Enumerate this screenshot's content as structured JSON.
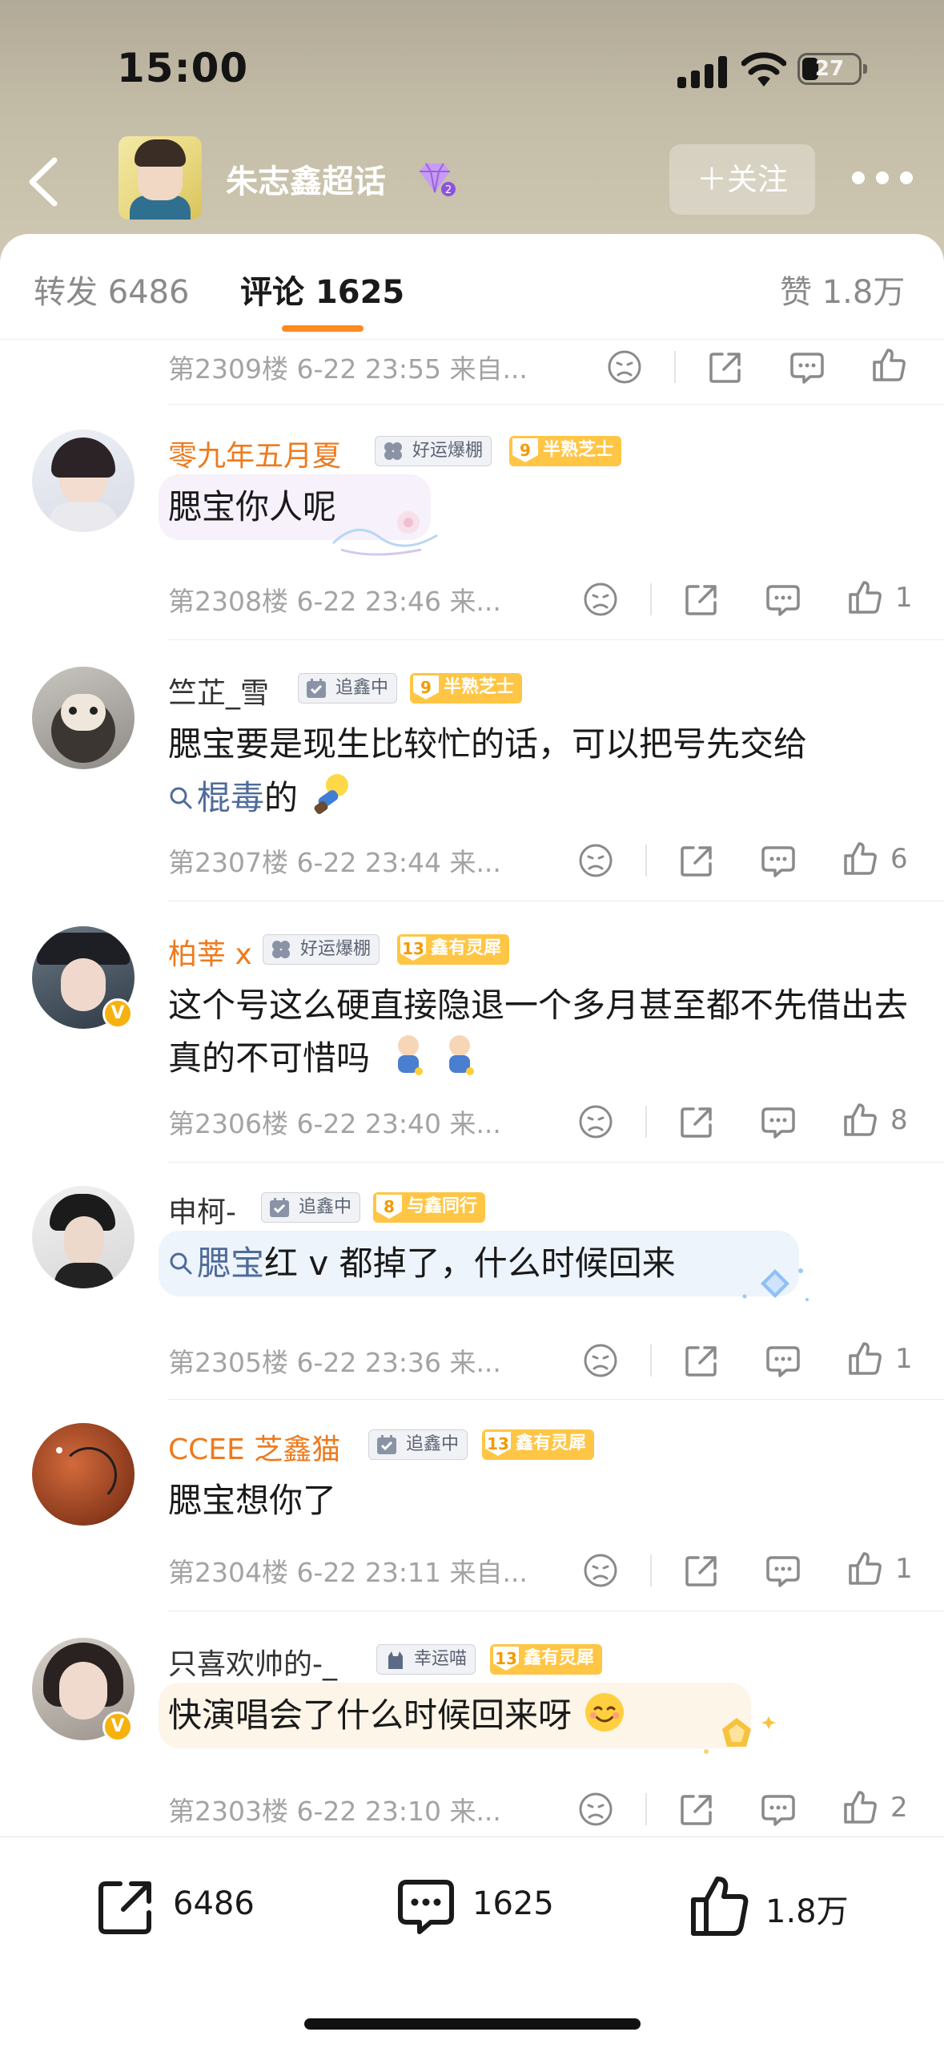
{
  "status_bar": {
    "time": "15:00",
    "battery": "27"
  },
  "nav": {
    "topic_name": "朱志鑫超话",
    "follow_label": "＋关注"
  },
  "tabs": [
    {
      "label": "转发 6486"
    },
    {
      "label": "评论 1625"
    },
    {
      "label": "赞 1.8万"
    }
  ],
  "top_partial": {
    "meta": "第2309楼  6-22 23:55  来自..."
  },
  "comments": [
    {
      "user": "零九年五月夏",
      "tag1": "好运爆棚",
      "tag2_level": "9",
      "tag2": "半熟芝士",
      "text": "腮宝你人呢",
      "meta": "第2308楼  6-22 23:46  来...",
      "likes": "1"
    },
    {
      "user": "竺芷_雪",
      "tag1": "追鑫中",
      "tag2_level": "9",
      "tag2": "半熟芝士",
      "text_pre": "腮宝要是现生比较忙的话，可以把号先交给",
      "link": "棍毒",
      "text_post": "的",
      "meta": "第2307楼  6-22 23:44  来...",
      "likes": "6"
    },
    {
      "user": "柏莘 x",
      "tag1": "好运爆棚",
      "tag2_level": "13",
      "tag2": "鑫有灵犀",
      "text": "这个号这么硬直接隐退一个多月甚至都不先借出去真的不可惜吗",
      "meta": "第2306楼  6-22 23:40  来...",
      "likes": "8"
    },
    {
      "user": "申柯-",
      "tag1": "追鑫中",
      "tag2_level": "8",
      "tag2": "与鑫同行",
      "link": "腮宝",
      "text_post": "红 v 都掉了，什么时候回来",
      "meta": "第2305楼  6-22 23:36  来...",
      "likes": "1"
    },
    {
      "user": "CCEE 芝鑫猫",
      "tag1": "追鑫中",
      "tag2_level": "13",
      "tag2": "鑫有灵犀",
      "text": "腮宝想你了",
      "meta": "第2304楼  6-22 23:11  来自...",
      "likes": "1"
    },
    {
      "user": "只喜欢帅的-_",
      "tag1": "幸运喵",
      "tag2_level": "13",
      "tag2": "鑫有灵犀",
      "text": "快演唱会了什么时候回来呀",
      "meta": "第2303楼  6-22 23:10  来...",
      "likes": "2"
    }
  ],
  "bottom_bar": {
    "repost": "6486",
    "comment": "1625",
    "like": "1.8万"
  },
  "colors": {
    "accent": "#ff8a1f",
    "vip_name": "#ee7a1d",
    "link": "#4f6b9b",
    "fan_badge": "#ffc545"
  },
  "icons": [
    "back-icon",
    "diamond-icon",
    "more-icon",
    "unlike-icon",
    "repost-icon",
    "comment-icon",
    "like-icon",
    "search-icon",
    "clover-icon",
    "checkin-icon",
    "cat-icon"
  ]
}
